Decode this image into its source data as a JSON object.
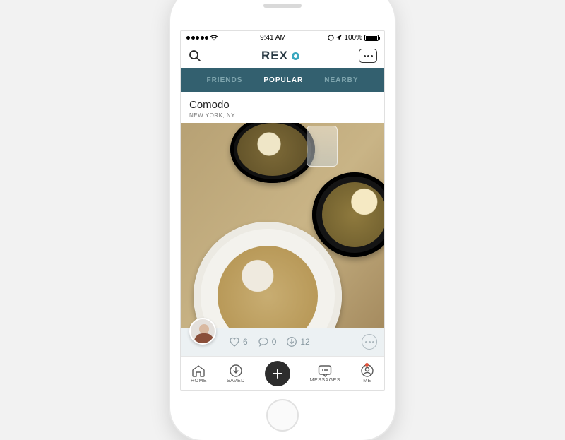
{
  "status": {
    "carrier_dots": 5,
    "time": "9:41 AM",
    "battery_pct": "100%"
  },
  "header": {
    "brand": "REX"
  },
  "tabs": [
    {
      "label": "FRIENDS",
      "active": false
    },
    {
      "label": "POPULAR",
      "active": true
    },
    {
      "label": "NEARBY",
      "active": false
    }
  ],
  "post": {
    "title": "Comodo",
    "location": "NEW YORK, NY",
    "stats": {
      "likes": "6",
      "comments": "0",
      "saves": "12"
    }
  },
  "nav": {
    "home": "HOME",
    "saved": "SAVED",
    "messages": "MESSAGES",
    "me": "ME",
    "me_badge": true
  }
}
